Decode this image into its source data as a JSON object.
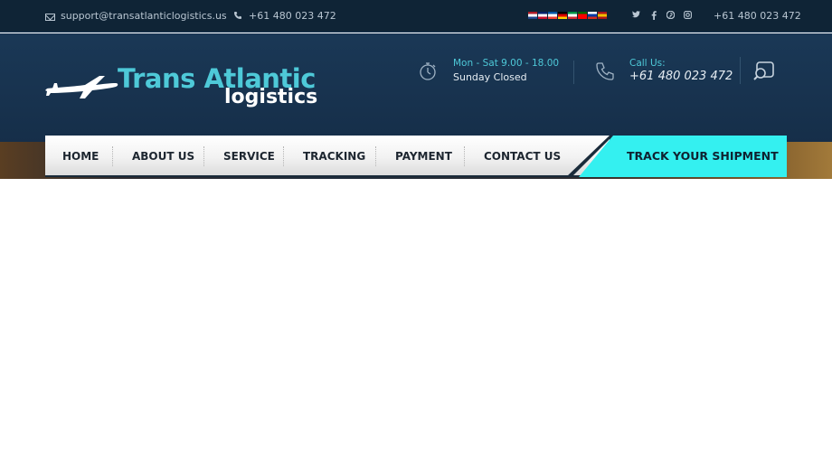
{
  "topbar": {
    "email": "support@transatlanticlogistics.us",
    "phone": "+61 480 023 472",
    "phone_right": "+61 480 023 472",
    "flags": [
      {
        "name": "flag-netherlands",
        "colors": [
          "#ae1c28",
          "#ffffff",
          "#21468b"
        ]
      },
      {
        "name": "flag-uk",
        "colors": [
          "#012169",
          "#ffffff",
          "#c8102e"
        ]
      },
      {
        "name": "flag-france",
        "colors": [
          "#0055a4",
          "#ffffff",
          "#ef4135"
        ]
      },
      {
        "name": "flag-germany",
        "colors": [
          "#000000",
          "#dd0000",
          "#ffce00"
        ]
      },
      {
        "name": "flag-italy",
        "colors": [
          "#009246",
          "#ffffff",
          "#ce2b37"
        ]
      },
      {
        "name": "flag-portugal",
        "colors": [
          "#006600",
          "#ff0000",
          "#ff0000"
        ]
      },
      {
        "name": "flag-russia",
        "colors": [
          "#ffffff",
          "#0039a6",
          "#d52b1e"
        ]
      },
      {
        "name": "flag-spain",
        "colors": [
          "#aa151b",
          "#f1bf00",
          "#aa151b"
        ]
      }
    ],
    "social": [
      "twitter-icon",
      "facebook-icon",
      "pinterest-icon",
      "instagram-icon"
    ]
  },
  "logo": {
    "title": "Trans Atlantic",
    "subtitle": "logistics"
  },
  "hours": {
    "line1": "Mon - Sat 9.00 - 18.00",
    "line2": "Sunday Closed"
  },
  "call": {
    "label": "Call Us:",
    "number": "+61 480 023 472"
  },
  "nav": {
    "items": [
      "HOME",
      "ABOUT US",
      "SERVICE",
      "TRACKING",
      "PAYMENT",
      "CONTACT US"
    ],
    "cta": "TRACK YOUR SHIPMENT"
  },
  "colors": {
    "accent": "#4ec9d8",
    "cta": "#34f0f0",
    "header": "#17324e",
    "topbar": "#0f2436"
  }
}
